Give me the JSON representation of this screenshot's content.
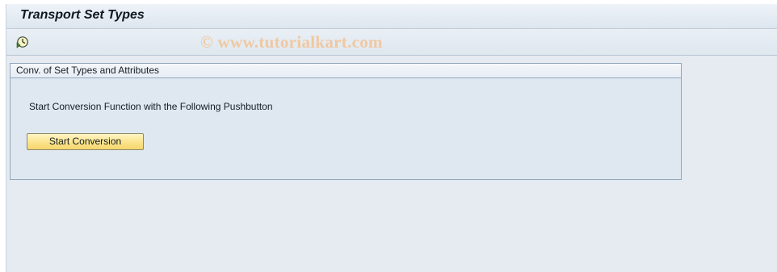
{
  "window": {
    "title": "Transport Set Types"
  },
  "toolbar": {
    "execute_icon": "execute-clock-icon",
    "watermark": "© www.tutorialkart.com"
  },
  "group": {
    "title": "Conv. of Set Types and Attributes",
    "info_text": "Start Conversion Function with the Following Pushbutton",
    "button_label": "Start Conversion"
  },
  "colors": {
    "background": "#e5ebf1",
    "button_fill": "#fbe48c",
    "group_border": "#92a6ba",
    "watermark": "#f0c8a0"
  }
}
